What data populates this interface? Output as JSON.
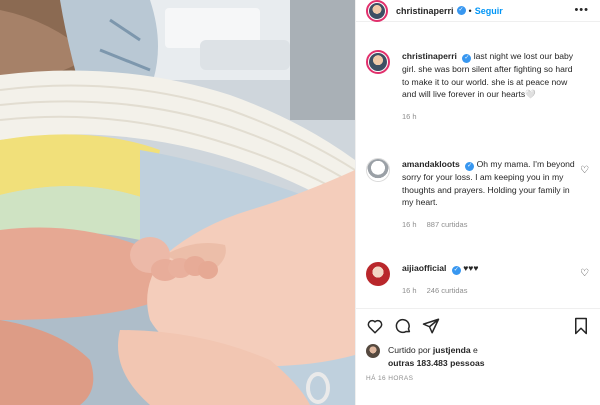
{
  "post": {
    "username": "christinaperri",
    "follow_label": "Seguir",
    "more_icon": "more-horizontal-icon",
    "caption": "last night we lost our baby girl. she was born silent after fighting so hard to make it to our world. she is at peace now and will live forever in our hearts🤍",
    "caption_time": "16 h"
  },
  "comments": [
    {
      "username": "amandakloots",
      "text": "Oh my mama. I'm beyond sorry for your loss. I am keeping you in my thoughts and prayers. Holding your family in my heart.",
      "time": "16 h",
      "likes": "887 curtidas"
    },
    {
      "username": "aijiaofficial",
      "text": "♥♥♥",
      "time": "16 h",
      "likes": "246 curtidas"
    }
  ],
  "likes": {
    "prefix": "Curtido por",
    "user": "justjenda",
    "connector": "e",
    "others": "outras 183.483 pessoas"
  },
  "timestamp": "HÁ 16 HORAS",
  "colors": {
    "verified": "#3897f0",
    "follow": "#0095f6",
    "secondary_text": "#8e8e8e",
    "border": "#efefef"
  }
}
